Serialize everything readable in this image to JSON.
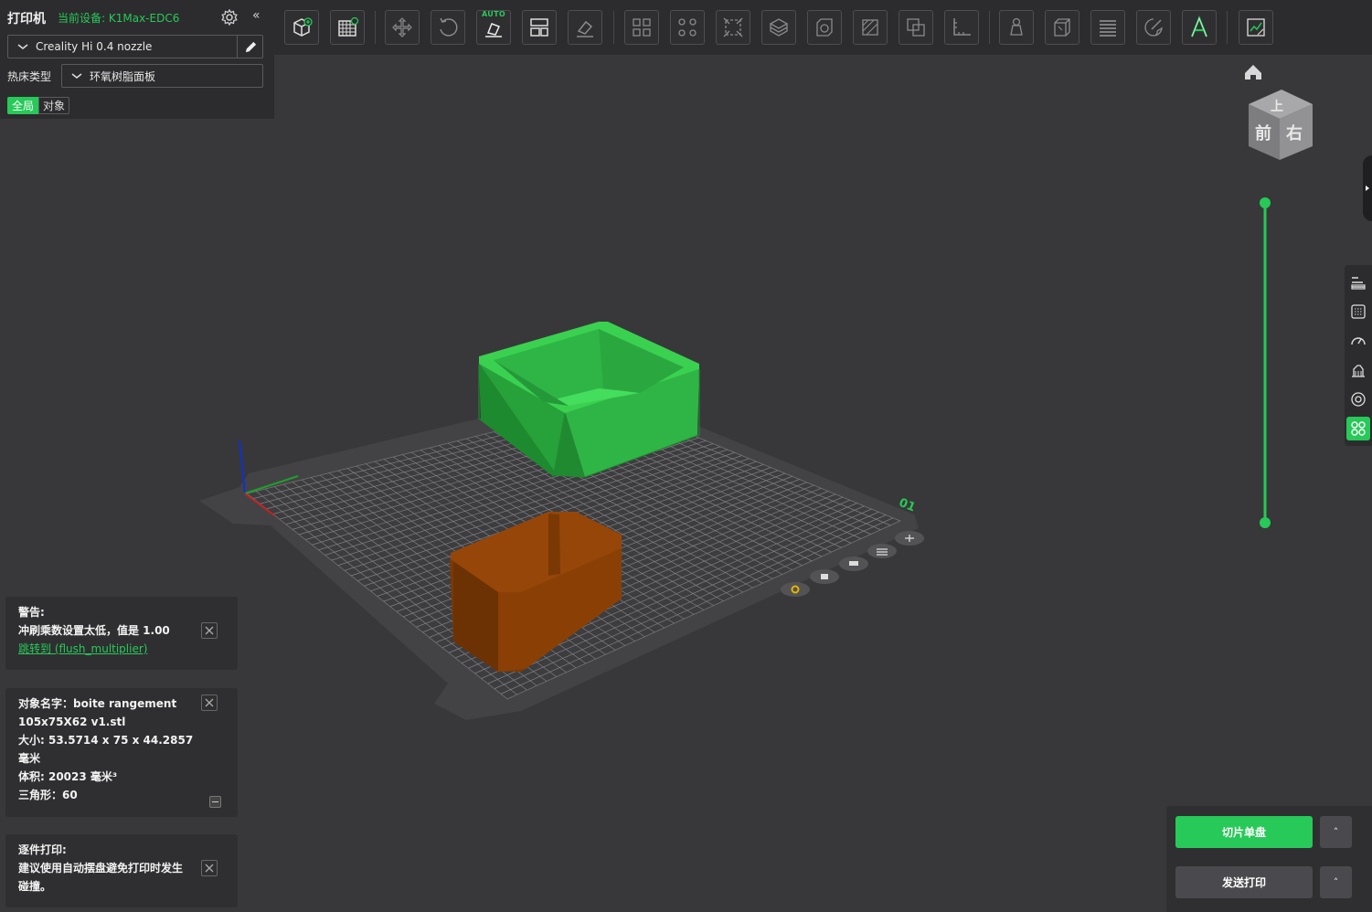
{
  "printer": {
    "title": "打印机",
    "current_device": "当前设备: K1Max-EDC6",
    "nozzle": "Creality Hi 0.4 nozzle",
    "bed_type_label": "热床类型",
    "bed_type_value": "环氧树脂面板",
    "tab_global": "全局",
    "tab_object": "对象"
  },
  "toolbar": {
    "auto_label": "AUTO",
    "tools": [
      "add-object-icon",
      "plate-grid-icon",
      "move-icon",
      "rotate-icon",
      "auto-arrange-icon",
      "layout-icon",
      "lay-on-face-icon",
      "split-objects-icon",
      "split-parts-icon",
      "scale-icon",
      "cut-icon",
      "hollow-icon",
      "support-paint-icon",
      "boolean-icon",
      "measure-icon",
      "seam-paint-icon",
      "shell-icon",
      "layers-icon",
      "color-paint-icon",
      "text-icon",
      "assembly-view-icon"
    ]
  },
  "view_cube": {
    "top": "上",
    "front": "前",
    "right": "右"
  },
  "plate": {
    "number": "01"
  },
  "notices": {
    "warning_title": "警告:",
    "warning_body": "冲刷乘数设置太低，值是 1.00",
    "warning_link": "跳转到 (flush_multiplier)",
    "object_name_line1": "对象名字：boite rangement",
    "object_name_line2": "105x75X62 v1.stl",
    "size_line1": "大小:   53.5714 x 75 x 44.2857",
    "size_line2": "毫米",
    "volume_line": "体积:   20023 毫米³",
    "triangles_line": "三角形：60",
    "sequential_title": "逐件打印:",
    "sequential_body1": "建议使用自动摆盘避免打印时发生",
    "sequential_body2": "碰撞。"
  },
  "actions": {
    "slice_label": "切片单盘",
    "send_label": "发送打印",
    "caret": "˄"
  },
  "colors": {
    "accent": "#27c958",
    "object_green": "#2fb545",
    "object_orange": "#8a4005",
    "background": "#38383a"
  }
}
